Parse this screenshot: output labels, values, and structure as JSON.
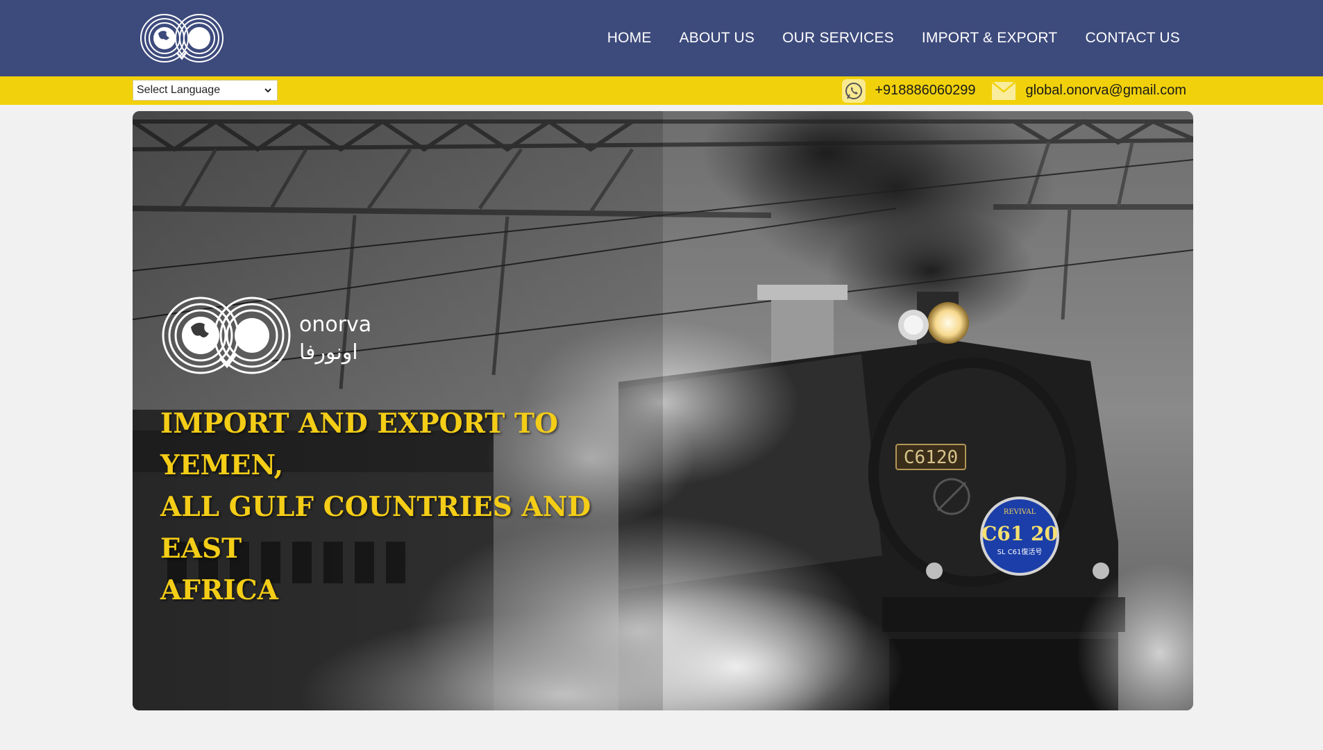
{
  "header": {
    "logo": "onorva-logo",
    "nav": [
      {
        "label": "HOME"
      },
      {
        "label": "ABOUT US"
      },
      {
        "label": "OUR SERVICES"
      },
      {
        "label": "IMPORT & EXPORT"
      },
      {
        "label": "CONTACT US"
      }
    ]
  },
  "strip": {
    "language_select": "Select Language",
    "phone": "+918886060299",
    "email": "global.onorva@gmail.com",
    "phone_icon": "whatsapp-icon",
    "email_icon": "mail-icon",
    "accent_color": "#f1d10b"
  },
  "hero": {
    "brand_name": "onorva",
    "brand_name_arabic": "اونورفا",
    "title_line1": "IMPORT AND EXPORT TO YEMEN,",
    "title_line2": "ALL GULF COUNTRIES AND EAST",
    "title_line3": "AFRICA",
    "engine_plate": "C6120",
    "badge_top": "REVIVAL",
    "badge_main": "C61 20",
    "badge_sub": "SL C61復活号",
    "title_color": "#f4cd17"
  },
  "colors": {
    "header_bg": "#3d4a7c",
    "page_bg": "#f1f1f1"
  }
}
